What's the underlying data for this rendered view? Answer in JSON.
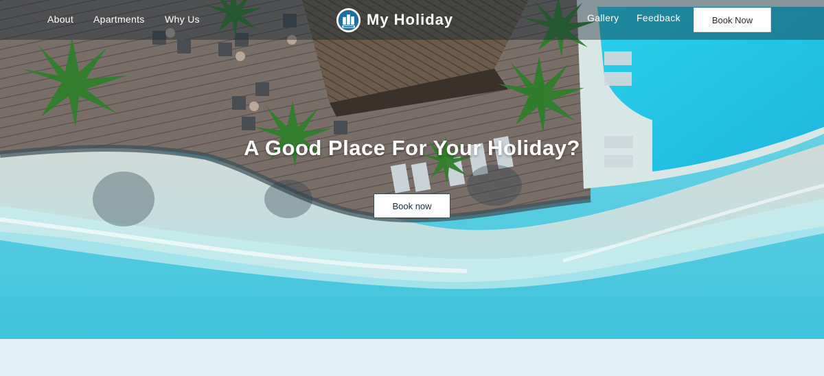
{
  "nav": {
    "links": [
      "About",
      "Apartments",
      "Why Us",
      "Gallery",
      "Feedback"
    ],
    "book_label": "Book Now"
  },
  "brand": {
    "name": "My Holiday",
    "logo_icon": "hotel-badge-icon"
  },
  "hero": {
    "title": "A Good Place For Your Holiday?",
    "button_label": "Book now"
  },
  "colors": {
    "nav_overlay": "#142632",
    "button_bg": "#ffffff",
    "button_text": "#1c2b38",
    "page_bg": "#e4f0f8",
    "water": "#43c9df"
  }
}
